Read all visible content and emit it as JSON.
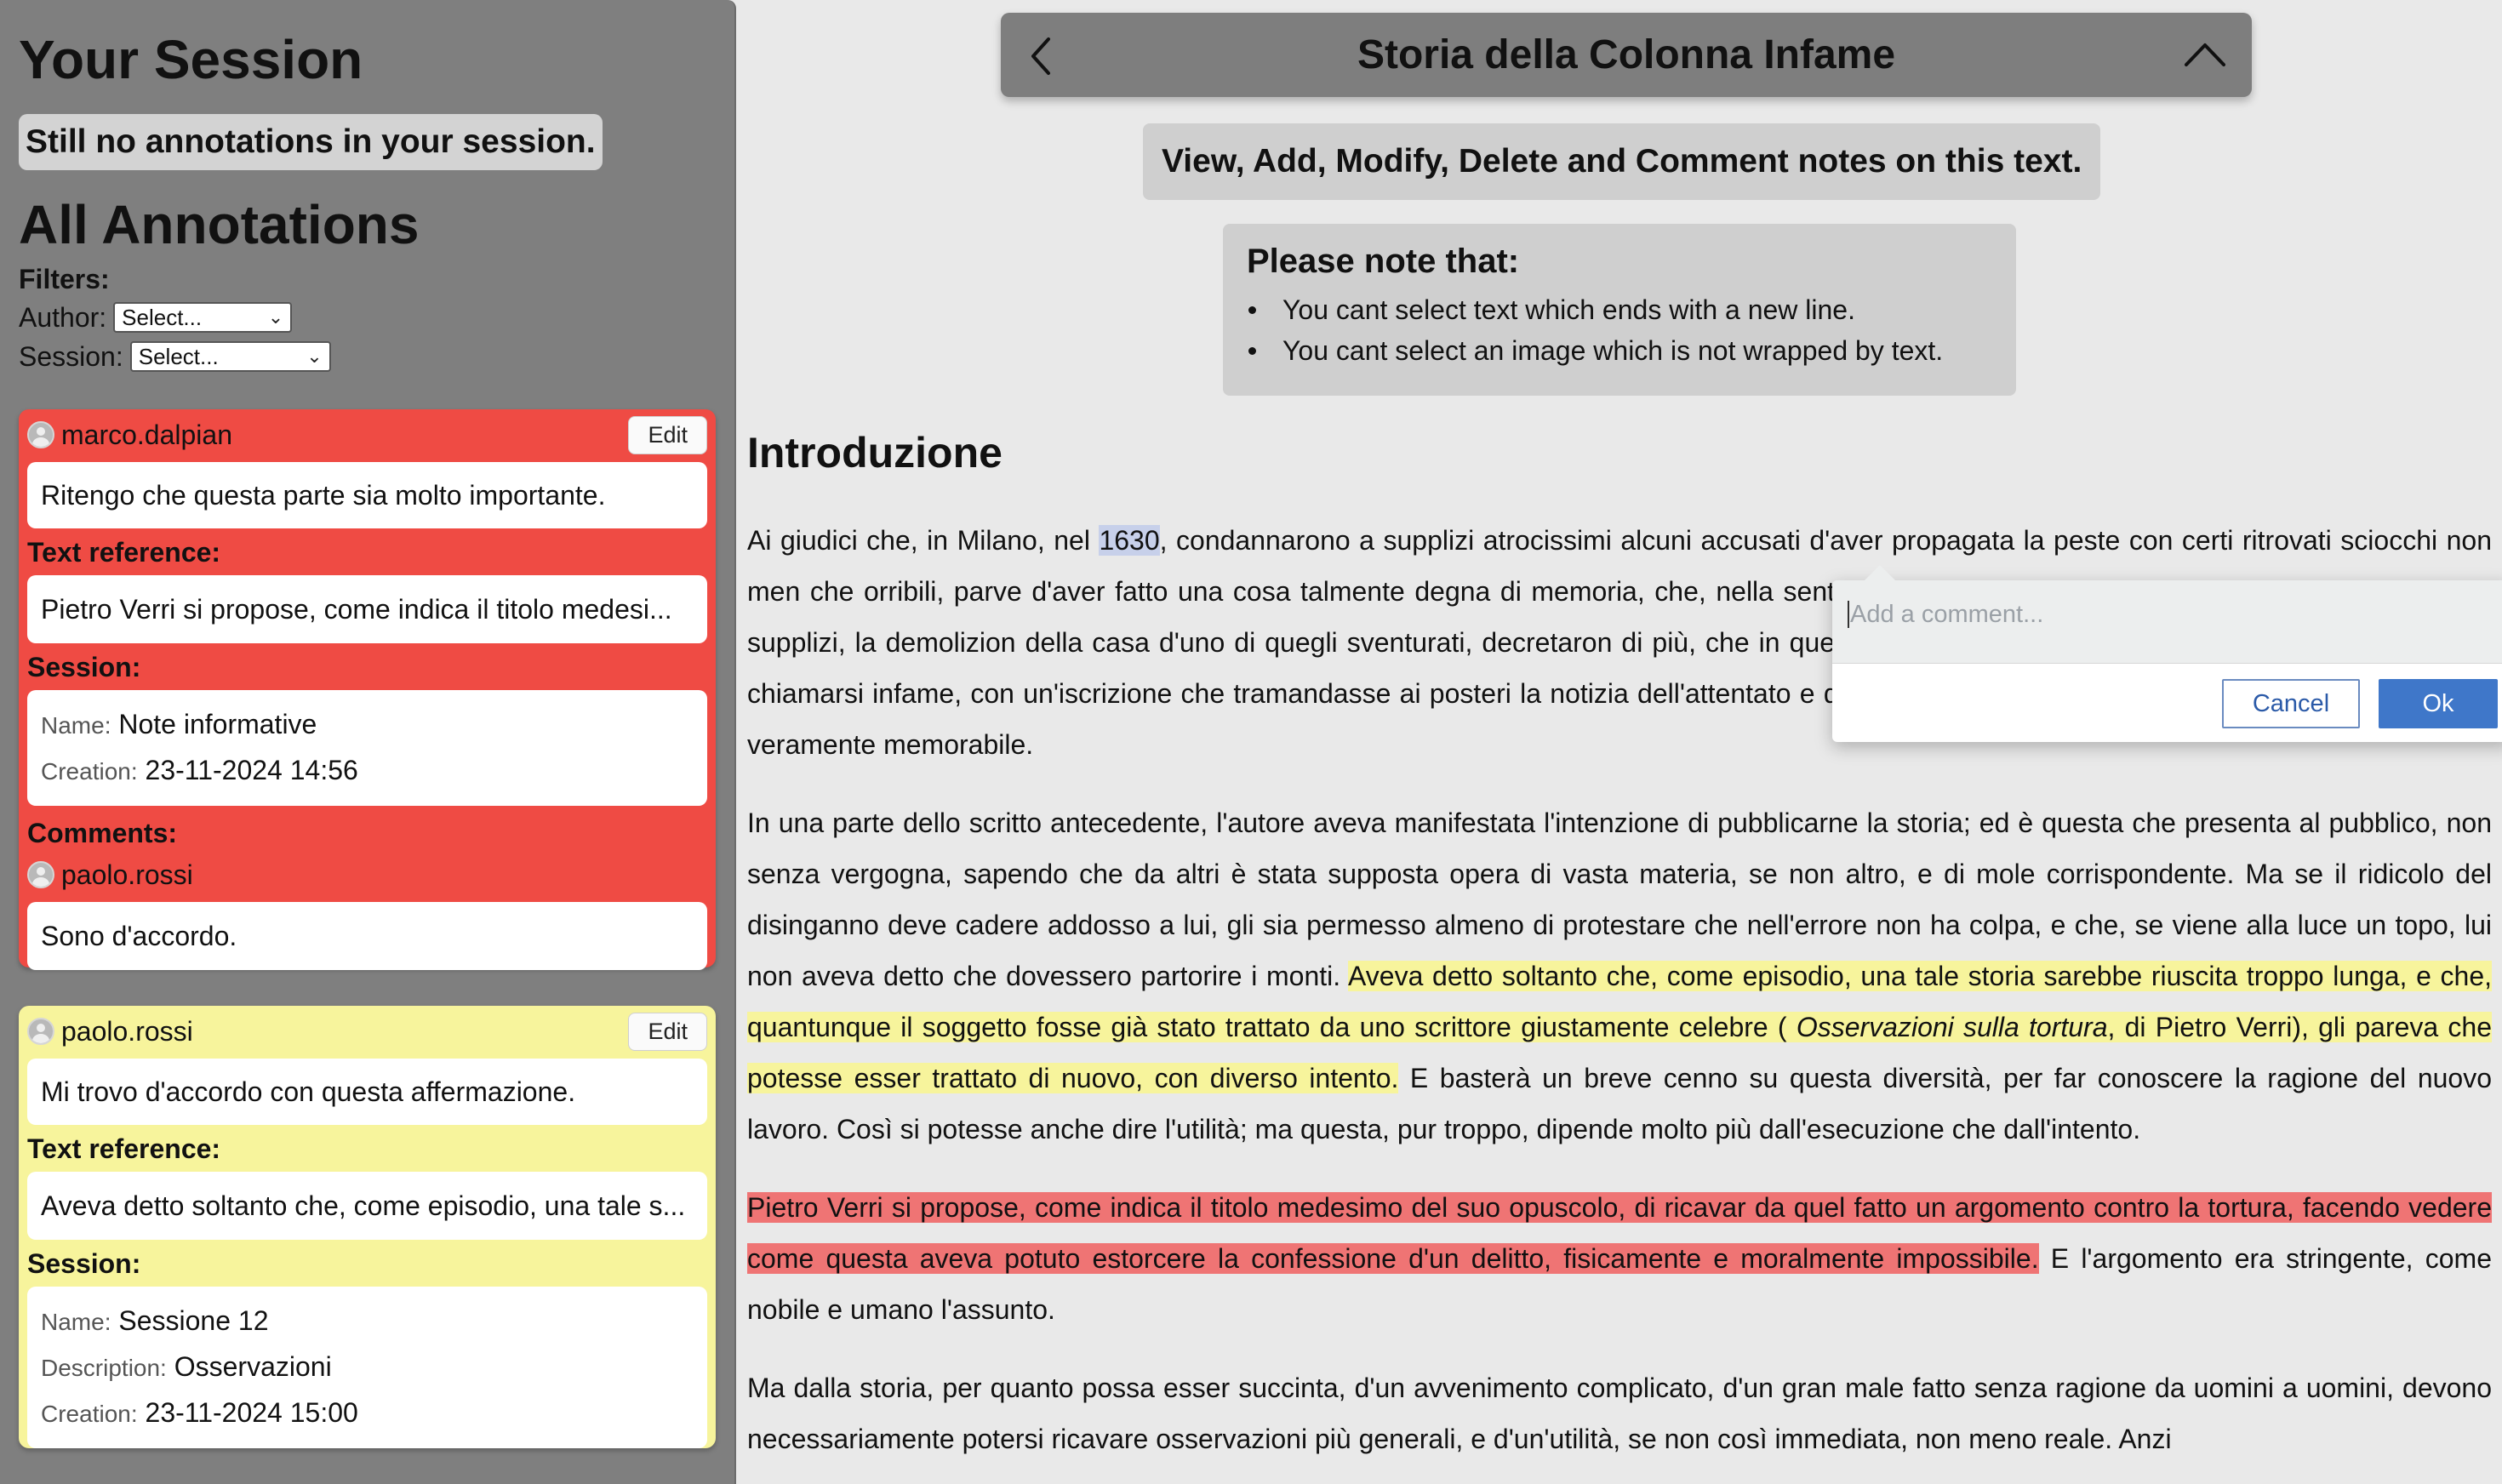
{
  "sidebar": {
    "session_title": "Your Session",
    "no_annotations": "Still no annotations in your session.",
    "all_title": "All Annotations",
    "filters_label": "Filters:",
    "author_label": "Author:",
    "author_value": "Select...",
    "session_label": "Session:",
    "session_value": "Select...",
    "annotations": [
      {
        "author": "marco.dalpian",
        "edit_label": "Edit",
        "body": "Ritengo che questa parte sia molto importante.",
        "text_ref_label": "Text reference:",
        "text_ref": "Pietro Verri si propose, come indica il titolo medesi...",
        "session_label": "Session:",
        "name_key": "Name:",
        "name_val": "Note informative",
        "creation_key": "Creation:",
        "creation_val": "23-11-2024 14:56",
        "comments_label": "Comments:",
        "comment_author": "paolo.rossi",
        "comment_text": "Sono d'accordo.",
        "color": "#ef4b44"
      },
      {
        "author": "paolo.rossi",
        "edit_label": "Edit",
        "body": "Mi trovo d'accordo con questa affermazione.",
        "text_ref_label": "Text reference:",
        "text_ref": "Aveva detto soltanto che, come episodio, una tale s...",
        "session_label": "Session:",
        "name_key": "Name:",
        "name_val": "Sessione 12",
        "desc_key": "Description:",
        "desc_val": "Osservazioni",
        "creation_key": "Creation:",
        "creation_val": "23-11-2024 15:00",
        "color": "#f7f49c"
      }
    ]
  },
  "header": {
    "title": "Storia della Colonna Infame",
    "subtitle": "View, Add, Modify, Delete and Comment notes on this text."
  },
  "note": {
    "title": "Please note that:",
    "items": [
      "You cant select text which ends with a new line.",
      "You cant select an image which is not wrapped by text."
    ]
  },
  "document": {
    "heading": "Introduzione",
    "p1_a": "Ai giudici che, in Milano, nel ",
    "p1_sel": "1630",
    "p1_b": ", condannarono a supplizi atrocissimi alcuni accusati d'aver propagata la peste con certi ritrovati sciocchi non men che orribili, parve d'aver fatto una cosa talmente degna di memoria, che, nella sentenza medesima, dopo aver decretata, in aggiunta de' supplizi, la demolizion della casa d'uno di quegli sventurati, decretaron di più, che in quello spazio s'innalzasse una colonna, la quale dovesse chiamarsi infame, con un'iscrizione che tramandasse ai posteri la notizia dell'attentato e della pena. E in ciò non s'ingannarono: quel giudizio fu veramente memorabile.",
    "p2_a": "In una parte dello scritto antecedente, l'autore aveva manifestata l'intenzione di pubblicarne la storia; ed è questa che presenta al pubblico, non senza vergogna, sapendo che da altri è stata supposta opera di vasta materia, se non altro, e di mole corrispondente. Ma se il ridicolo del disinganno deve cadere addosso a lui, gli sia permesso almeno di protestare che nell'errore non ha colpa, e che, se viene alla luce un topo, lui non aveva detto che dovessero partorire i monti. ",
    "p2_hl_a": "Aveva detto soltanto che, come episodio, una tale storia sarebbe riuscita troppo lunga, e che, quantunque il soggetto fosse già stato trattato da uno scrittore giustamente celebre ( ",
    "p2_hl_italic": "Osservazioni sulla tortura",
    "p2_hl_b": ", di Pietro Verri), gli pareva che potesse esser trattato di nuovo, con diverso intento.",
    "p2_b": " E basterà un breve cenno su questa diversità, per far conoscere la ragione del nuovo lavoro. Così si potesse anche dire l'utilità; ma questa, pur troppo, dipende molto più dall'esecuzione che dall'intento.",
    "p3_hl": "Pietro Verri si propose, come indica il titolo medesimo del suo opuscolo, di ricavar da quel fatto un argomento contro la tortura, facendo vedere come questa aveva potuto estorcere la confessione d'un delitto, fisicamente e moralmente impossibile.",
    "p3_b": " E l'argomento era stringente, come nobile e umano l'assunto.",
    "p4": "Ma dalla storia, per quanto possa esser succinta, d'un avvenimento complicato, d'un gran male fatto senza ragione da uomini a uomini, devono necessariamente potersi ricavare osservazioni più generali, e d'un'utilità, se non così immediata, non meno reale. Anzi"
  },
  "popup": {
    "placeholder": "Add a comment...",
    "cancel": "Cancel",
    "ok": "Ok"
  },
  "icons": {
    "back": "chevron-left-icon",
    "collapse": "chevron-up-icon",
    "avatar": "user-avatar-icon",
    "select": "chevron-down-icon"
  }
}
